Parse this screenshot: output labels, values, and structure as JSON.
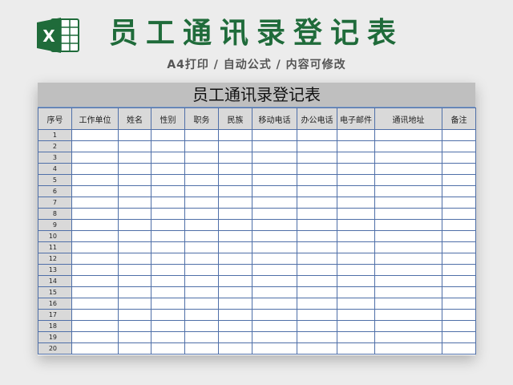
{
  "header": {
    "title": "员工通讯录登记表",
    "subtitle": "A4打印 / 自动公式 / 内容可修改",
    "logo_letter": "X",
    "logo_color": "#1f6b3a"
  },
  "sheet": {
    "title": "员工通讯录登记表",
    "columns": [
      "序号",
      "工作单位",
      "姓名",
      "性别",
      "职务",
      "民族",
      "移动电话",
      "办公电话",
      "电子邮件",
      "通讯地址",
      "备注"
    ],
    "row_numbers": [
      "1",
      "2",
      "3",
      "4",
      "5",
      "6",
      "7",
      "8",
      "9",
      "10",
      "11",
      "12",
      "13",
      "14",
      "15",
      "16",
      "17",
      "18",
      "19",
      "20"
    ]
  }
}
